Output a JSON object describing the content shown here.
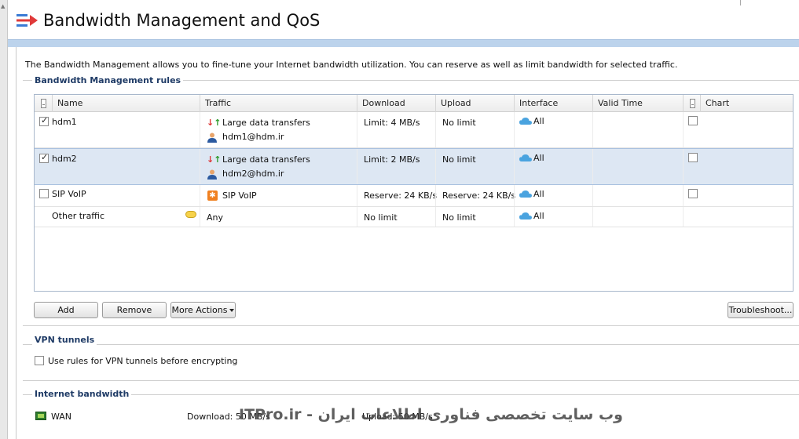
{
  "header": {
    "title": "Bandwidth Management and QoS"
  },
  "description": "The Bandwidth Management allows you to fine-tune your Internet bandwidth utilization. You can reserve as well as limit bandwidth for selected traffic.",
  "bandwidth_rules": {
    "legend": "Bandwidth Management rules",
    "columns": {
      "name": "Name",
      "traffic": "Traffic",
      "download": "Download",
      "upload": "Upload",
      "interface": "Interface",
      "valid_time": "Valid Time",
      "chart": "Chart"
    },
    "rows": [
      {
        "enabled": true,
        "name": "hdm1",
        "traffic_type": "Large data transfers",
        "traffic_user": "hdm1@hdm.ir",
        "download": "Limit: 4 MB/s",
        "upload": "No limit",
        "interface": "All",
        "valid_time": "",
        "chart": false
      },
      {
        "enabled": true,
        "name": "hdm2",
        "traffic_type": "Large data transfers",
        "traffic_user": "hdm2@hdm.ir",
        "download": "Limit: 2 MB/s",
        "upload": "No limit",
        "interface": "All",
        "valid_time": "",
        "chart": false,
        "selected": true
      },
      {
        "enabled": false,
        "name": "SIP VoIP",
        "traffic_type": "SIP VoIP",
        "download": "Reserve: 24 KB/s",
        "upload": "Reserve: 24 KB/s",
        "interface": "All",
        "valid_time": "",
        "chart": false
      },
      {
        "name": "Other traffic",
        "traffic_type": "Any",
        "download": "No limit",
        "upload": "No limit",
        "interface": "All",
        "valid_time": ""
      }
    ],
    "buttons": {
      "add": "Add",
      "remove": "Remove",
      "more_actions": "More Actions",
      "troubleshoot": "Troubleshoot..."
    }
  },
  "vpn_tunnels": {
    "legend": "VPN tunnels",
    "checkbox_label": "Use rules for VPN tunnels before encrypting",
    "checked": false
  },
  "internet_bandwidth": {
    "legend": "Internet bandwidth",
    "interface": "WAN",
    "download": "Download: 50 MB/s",
    "upload": "Upload: 50 MB/s"
  },
  "watermark": "ITPro.ir - وب سایت تخصصی فناوری اطلاعات ایران",
  "colors": {
    "accent_blue": "#bcd3ec",
    "legend_blue": "#1f3b66",
    "selected_row": "#dde7f3"
  },
  "icons": {
    "title": "bandwidth-arrows-icon",
    "traffic_large": "up-down-arrows-icon",
    "traffic_user": "user-icon",
    "traffic_voip": "voip-icon",
    "interface": "cloud-icon",
    "other_traffic": "comment-bubble-icon",
    "wan": "network-card-icon"
  }
}
